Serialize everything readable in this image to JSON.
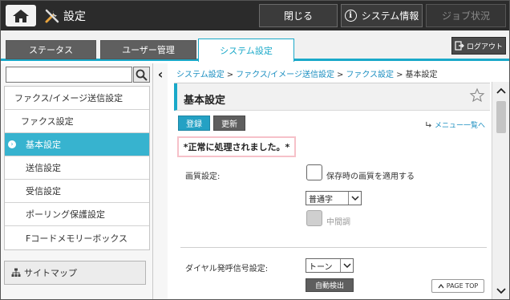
{
  "header": {
    "title": "設定",
    "close_label": "閉じる",
    "system_info_label": "システム情報",
    "job_status_label": "ジョブ状況",
    "info_glyph": "i"
  },
  "tabs": [
    {
      "label": "ステータス",
      "active": false
    },
    {
      "label": "ユーザー管理",
      "active": false
    },
    {
      "label": "システム設定",
      "active": true
    }
  ],
  "logout_label": "ログアウト",
  "sidebar": {
    "search_value": "",
    "items": [
      {
        "label": "ファクス/イメージ送信設定",
        "level": 0,
        "active": false
      },
      {
        "label": "ファクス設定",
        "level": 1,
        "active": false
      },
      {
        "label": "基本設定",
        "level": 2,
        "active": true
      },
      {
        "label": "送信設定",
        "level": 2,
        "active": false
      },
      {
        "label": "受信設定",
        "level": 2,
        "active": false
      },
      {
        "label": "ポーリング保護設定",
        "level": 2,
        "active": false
      },
      {
        "label": "Fコードメモリーボックス",
        "level": 2,
        "active": false
      }
    ],
    "sitemap_label": "サイトマップ",
    "active_bullet": "›"
  },
  "breadcrumb": {
    "items": [
      "システム設定",
      "ファクス/イメージ送信設定",
      "ファクス設定"
    ],
    "current": "基本設定",
    "separator": ">"
  },
  "panel": {
    "title": "基本設定",
    "register_label": "登録",
    "update_label": "更新",
    "menu_list_label": "メニュー一覧へ",
    "message": "*正常に処理されました。*",
    "image_quality_label": "画質設定:",
    "apply_saved_quality_label": "保存時の画質を適用する",
    "apply_saved_quality_checked": false,
    "resolution_value": "普通字",
    "halftone_label": "中間調",
    "halftone_enabled": false,
    "dial_signal_label": "ダイヤル発呼信号設定:",
    "dial_signal_value": "トーン",
    "auto_detect_label": "自動検出",
    "page_top_label": "PAGE TOP"
  },
  "colors": {
    "accent": "#1aa9c9",
    "active_menu": "#37b3cf",
    "topbar": "#2b2b2b",
    "message_border": "#f6c1c9"
  },
  "icons": {
    "home": "home-icon",
    "settings": "tools-icon",
    "info": "info-icon",
    "logout": "logout-icon",
    "search": "search-icon",
    "sitemap": "sitemap-icon",
    "favorite": "star-icon",
    "scroll_up": "chevron-up-icon",
    "scroll_down": "chevron-down-icon"
  }
}
